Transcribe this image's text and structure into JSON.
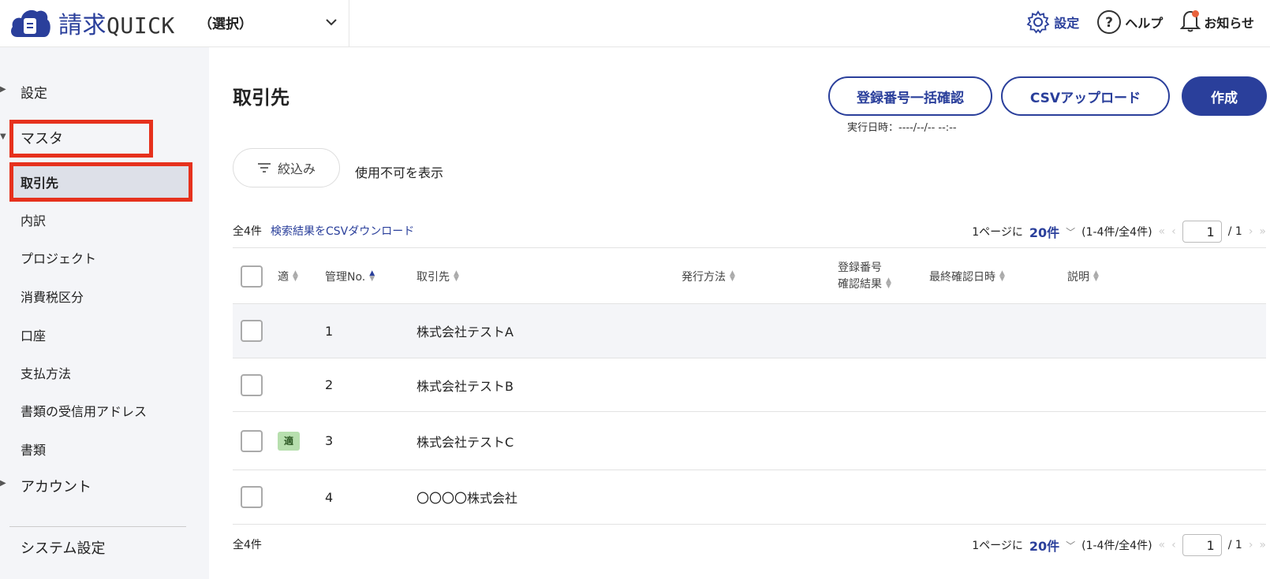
{
  "header": {
    "logo_text_ja": "請求",
    "logo_text_en": "QUICK",
    "org_select": "（選択）",
    "settings": "設定",
    "help": "ヘルプ",
    "notifications": "お知らせ",
    "accent": "#2a3f9b"
  },
  "sidebar": {
    "items": [
      {
        "label": "設定",
        "type": "group"
      },
      {
        "label": "マスタ",
        "type": "group-open"
      },
      {
        "label": "取引先",
        "type": "active"
      },
      {
        "label": "内訳"
      },
      {
        "label": "プロジェクト"
      },
      {
        "label": "消費税区分"
      },
      {
        "label": "口座"
      },
      {
        "label": "支払方法"
      },
      {
        "label": "書類の受信用アドレス"
      },
      {
        "label": "書類"
      },
      {
        "label": "アカウント",
        "type": "group"
      },
      {
        "label": "システム設定"
      }
    ]
  },
  "main": {
    "title": "取引先",
    "bulk_check_button": "登録番号一括確認",
    "csv_upload_button": "CSVアップロード",
    "create_button": "作成",
    "exec_date": "実行日時：----/--/-- --:--",
    "filter_button": "絞込み",
    "show_disabled": "使用不可を表示",
    "total": "全4件",
    "csv_download": "検索結果をCSVダウンロード",
    "pager": {
      "per_page_prefix": "1ページに",
      "per_page": "20件",
      "range": "(1-4件/全4件)",
      "page": "1",
      "total_pages": "/ 1"
    },
    "columns": [
      "適",
      "管理No.",
      "取引先",
      "発行方法",
      "登録番号",
      "確認結果",
      "最終確認日時",
      "説明"
    ],
    "rows": [
      {
        "badge": "",
        "no": "1",
        "name": "株式会社テストA"
      },
      {
        "badge": "",
        "no": "2",
        "name": "株式会社テストB"
      },
      {
        "badge": "適",
        "no": "3",
        "name": "株式会社テストC"
      },
      {
        "badge": "",
        "no": "4",
        "name": "〇〇〇〇株式会社"
      }
    ]
  }
}
